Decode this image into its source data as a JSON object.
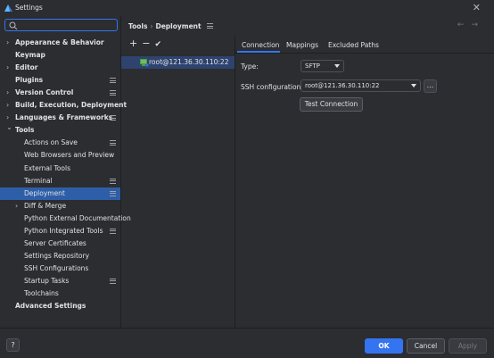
{
  "window": {
    "title": "Settings",
    "close_glyph": "✕"
  },
  "search": {
    "placeholder": "",
    "icon": "search-icon"
  },
  "sidebar": {
    "items": [
      {
        "label": "Appearance & Behavior",
        "bold": true,
        "expandable": true,
        "menu": false,
        "indent": 1
      },
      {
        "label": "Keymap",
        "bold": true,
        "expandable": false,
        "menu": false,
        "indent": 1
      },
      {
        "label": "Editor",
        "bold": true,
        "expandable": true,
        "menu": false,
        "indent": 1
      },
      {
        "label": "Plugins",
        "bold": true,
        "expandable": false,
        "menu": true,
        "indent": 1
      },
      {
        "label": "Version Control",
        "bold": true,
        "expandable": true,
        "menu": true,
        "indent": 1
      },
      {
        "label": "Build, Execution, Deployment",
        "bold": true,
        "expandable": true,
        "menu": false,
        "indent": 1
      },
      {
        "label": "Languages & Frameworks",
        "bold": true,
        "expandable": true,
        "menu": true,
        "indent": 1
      },
      {
        "label": "Tools",
        "bold": true,
        "expandable": true,
        "expanded": true,
        "menu": false,
        "indent": 1
      },
      {
        "label": "Actions on Save",
        "bold": false,
        "expandable": false,
        "menu": true,
        "indent": 2
      },
      {
        "label": "Web Browsers and Preview",
        "bold": false,
        "expandable": false,
        "menu": false,
        "indent": 2
      },
      {
        "label": "External Tools",
        "bold": false,
        "expandable": false,
        "menu": false,
        "indent": 2
      },
      {
        "label": "Terminal",
        "bold": false,
        "expandable": false,
        "menu": true,
        "indent": 2
      },
      {
        "label": "Deployment",
        "bold": false,
        "expandable": false,
        "menu": true,
        "indent": 2,
        "selected": true
      },
      {
        "label": "Diff & Merge",
        "bold": false,
        "expandable": true,
        "menu": false,
        "indent": 2
      },
      {
        "label": "Python External Documentation",
        "bold": false,
        "expandable": false,
        "menu": false,
        "indent": 2
      },
      {
        "label": "Python Integrated Tools",
        "bold": false,
        "expandable": false,
        "menu": true,
        "indent": 2
      },
      {
        "label": "Server Certificates",
        "bold": false,
        "expandable": false,
        "menu": false,
        "indent": 2
      },
      {
        "label": "Settings Repository",
        "bold": false,
        "expandable": false,
        "menu": false,
        "indent": 2
      },
      {
        "label": "SSH Configurations",
        "bold": false,
        "expandable": false,
        "menu": false,
        "indent": 2
      },
      {
        "label": "Startup Tasks",
        "bold": false,
        "expandable": false,
        "menu": true,
        "indent": 2
      },
      {
        "label": "Toolchains",
        "bold": false,
        "expandable": false,
        "menu": false,
        "indent": 2
      },
      {
        "label": "Advanced Settings",
        "bold": true,
        "expandable": false,
        "menu": false,
        "indent": 1
      }
    ]
  },
  "breadcrumb": {
    "parent": "Tools",
    "separator": "›",
    "current": "Deployment"
  },
  "servers": {
    "toolbar": {
      "add": "+",
      "remove": "−",
      "default": "✔"
    },
    "items": [
      {
        "label": "root@121.36.30.110:22",
        "icon": "sftp-server-icon"
      }
    ]
  },
  "tabs": [
    {
      "label": "Connection",
      "active": true
    },
    {
      "label": "Mappings"
    },
    {
      "label": "Excluded Paths"
    }
  ],
  "connection": {
    "type_label": "Type:",
    "type_value": "SFTP",
    "ssh_label": "SSH configuration:",
    "ssh_value": "root@121.36.30.110:22",
    "browse_label": "...",
    "test_button": "Test Connection"
  },
  "footer": {
    "help": "?",
    "ok": "OK",
    "cancel": "Cancel",
    "apply": "Apply"
  },
  "colors": {
    "accent": "#3574f0",
    "selection": "#2e5ea8",
    "background": "#2b2d30"
  }
}
